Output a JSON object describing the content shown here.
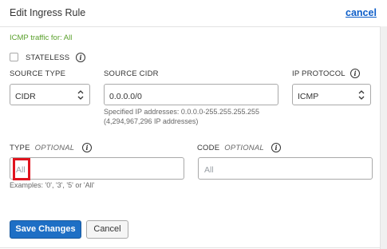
{
  "header": {
    "title": "Edit Ingress Rule",
    "cancel_link": "cancel"
  },
  "info_text": "ICMP traffic for: All",
  "stateless": {
    "label": "STATELESS",
    "checked": false
  },
  "source_type": {
    "label": "SOURCE TYPE",
    "value": "CIDR"
  },
  "source_cidr": {
    "label": "SOURCE CIDR",
    "value": "0.0.0.0/0",
    "help_line1": "Specified IP addresses: 0.0.0.0-255.255.255.255",
    "help_line2": "(4,294,967,296 IP addresses)"
  },
  "ip_protocol": {
    "label": "IP PROTOCOL",
    "value": "ICMP"
  },
  "type_field": {
    "label": "TYPE",
    "optional": "OPTIONAL",
    "placeholder": "All",
    "help": "Examples: '0', '3', '5' or 'All'"
  },
  "code_field": {
    "label": "CODE",
    "optional": "OPTIONAL",
    "placeholder": "All"
  },
  "buttons": {
    "save": "Save Changes",
    "cancel": "Cancel"
  },
  "icons": {
    "info": "i"
  },
  "colors": {
    "primary": "#1e6fc5",
    "link": "#0d5ec9",
    "info_text": "#5aa02c",
    "highlight": "#e0141e"
  }
}
